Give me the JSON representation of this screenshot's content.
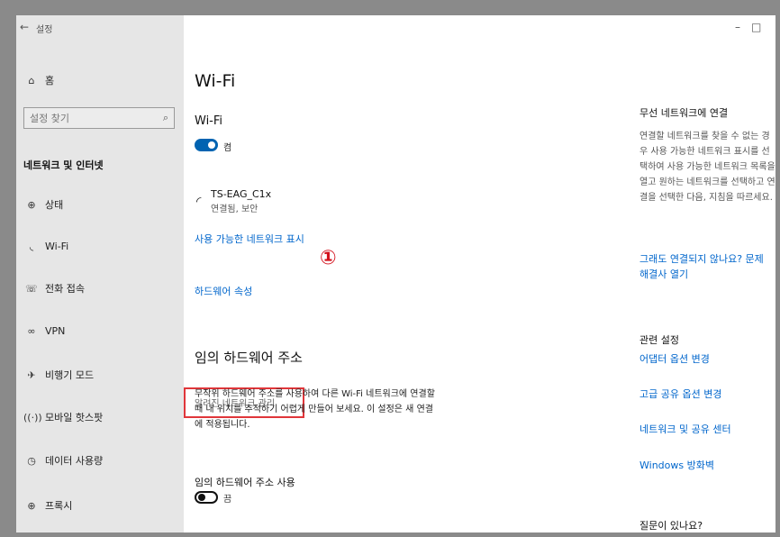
{
  "window": {
    "back_icon": "←",
    "title": "설정",
    "minimize": "–",
    "maximize": "□"
  },
  "sidebar": {
    "home_label": "홈",
    "search_placeholder": "설정 찾기",
    "section_header": "네트워크 및 인터넷",
    "items": [
      {
        "label": "상태",
        "icon": "status-icon"
      },
      {
        "label": "Wi-Fi",
        "icon": "wifi-icon"
      },
      {
        "label": "전화 접속",
        "icon": "dialup-icon"
      },
      {
        "label": "VPN",
        "icon": "vpn-icon"
      },
      {
        "label": "비행기 모드",
        "icon": "airplane-icon"
      },
      {
        "label": "모바일 핫스팟",
        "icon": "hotspot-icon"
      },
      {
        "label": "데이터 사용량",
        "icon": "data-usage-icon"
      },
      {
        "label": "프록시",
        "icon": "globe-icon"
      }
    ]
  },
  "main": {
    "page_title": "Wi-Fi",
    "wifi_label": "Wi-Fi",
    "wifi_toggle_state": "켬",
    "network": {
      "name": "TS-EAG_C1x",
      "status": "연결됨, 보안"
    },
    "show_networks_link": "사용 가능한 네트워크 표시",
    "hardware_props_link": "하드웨어 속성",
    "manage_known_link": "알려진 네트워크 관리",
    "step_marker": "①",
    "random_hw_heading": "임의 하드웨어 주소",
    "random_hw_desc": "무작위 하드웨어 주소를 사용하여 다른 Wi-Fi 네트워크에 연결할 때 내 위치를 추적하기 어렵게 만들어 보세요. 이 설정은 새 연결에 적용됩니다.",
    "random_hw_use_label": "임의 하드웨어 주소 사용",
    "random_hw_toggle_state": "끔"
  },
  "right_panel": {
    "wireless_heading": "무선 네트워크에 연결",
    "wireless_desc": "연결할 네트워크를 찾을 수 없는 경우 사용 가능한 네트워크 표시를 선택하여 사용 가능한 네트워크 목록을 열고 원하는 네트워크를 선택하고 연결을 선택한 다음, 지침을 따르세요.",
    "troubleshoot_link": "그래도 연결되지 않나요? 문제 해결사 열기",
    "related_heading": "관련 설정",
    "adapter_link": "어댑터 옵션 변경",
    "sharing_link": "고급 공유 옵션 변경",
    "network_center_link": "네트워크 및 공유 센터",
    "firewall_link": "Windows 방화벽",
    "question_heading": "질문이 있나요?"
  }
}
